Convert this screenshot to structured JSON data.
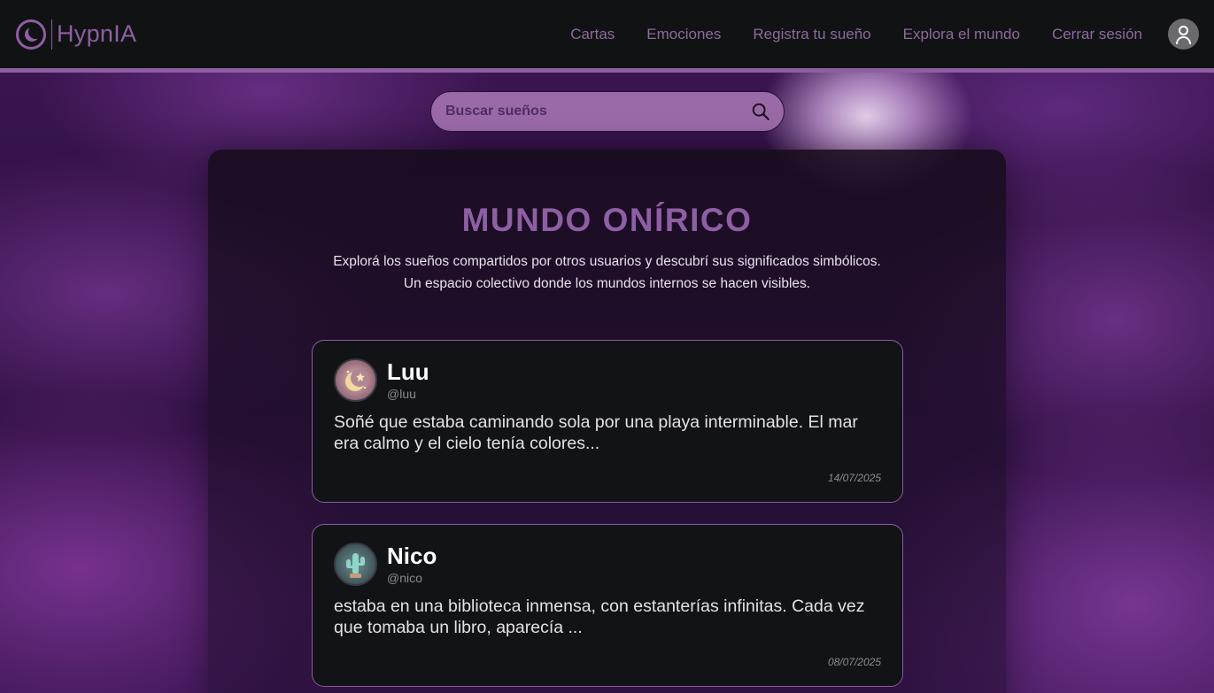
{
  "brand": {
    "name": "HypnIA",
    "color": "#8e5fa3"
  },
  "nav": {
    "links": [
      "Cartas",
      "Emociones",
      "Registra tu sueño",
      "Explora el mundo",
      "Cerrar sesión"
    ]
  },
  "search": {
    "placeholder": "Buscar sueños",
    "value": ""
  },
  "page": {
    "title": "MUNDO ONÍRICO",
    "subtitle_line1": "Explorá los sueños compartidos por otros usuarios y descubrí sus significados simbólicos.",
    "subtitle_line2": "Un espacio colectivo donde los mundos internos se hacen visibles."
  },
  "dreams": [
    {
      "name": "Luu",
      "handle": "@luu",
      "avatar_icon": "moon-stars-icon",
      "text": "Soñé que estaba caminando sola por una playa interminable. El mar era calmo y el cielo tenía colores...",
      "date": "14/07/2025"
    },
    {
      "name": "Nico",
      "handle": "@nico",
      "avatar_icon": "cactus-icon",
      "text": "estaba en una biblioteca inmensa, con estanterías infinitas. Cada vez que tomaba un libro, aparecía ...",
      "date": "08/07/2025"
    }
  ],
  "colors": {
    "accent": "#8e5fa3",
    "navbar_bg": "#111214",
    "card_bg": "#111317",
    "search_bg": "#9a6aa8"
  }
}
